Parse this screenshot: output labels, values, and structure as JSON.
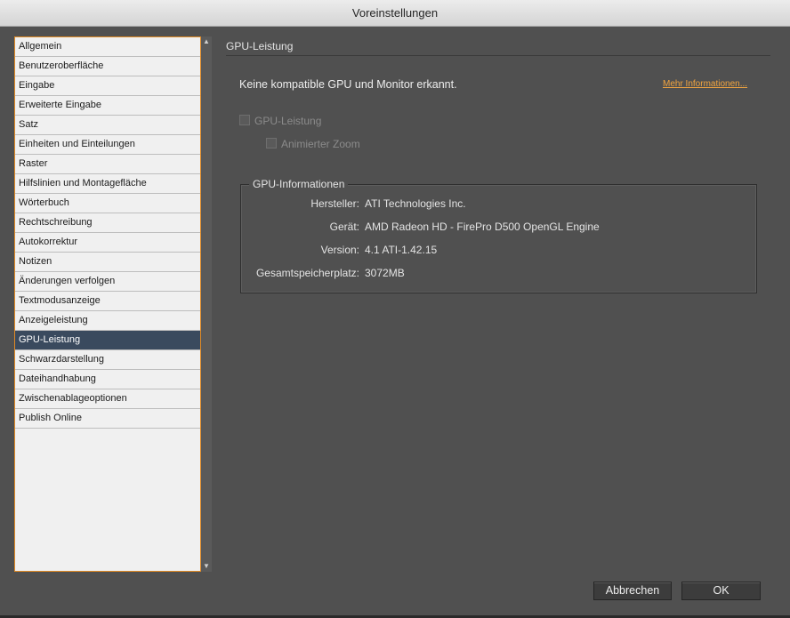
{
  "window": {
    "title": "Voreinstellungen"
  },
  "sidebar": {
    "items": [
      {
        "label": "Allgemein",
        "selected": false
      },
      {
        "label": "Benutzeroberfläche",
        "selected": false
      },
      {
        "label": "Eingabe",
        "selected": false
      },
      {
        "label": "Erweiterte Eingabe",
        "selected": false
      },
      {
        "label": "Satz",
        "selected": false
      },
      {
        "label": "Einheiten und Einteilungen",
        "selected": false
      },
      {
        "label": "Raster",
        "selected": false
      },
      {
        "label": "Hilfslinien und Montagefläche",
        "selected": false
      },
      {
        "label": "Wörterbuch",
        "selected": false
      },
      {
        "label": "Rechtschreibung",
        "selected": false
      },
      {
        "label": "Autokorrektur",
        "selected": false
      },
      {
        "label": "Notizen",
        "selected": false
      },
      {
        "label": "Änderungen verfolgen",
        "selected": false
      },
      {
        "label": "Textmodusanzeige",
        "selected": false
      },
      {
        "label": "Anzeigeleistung",
        "selected": false
      },
      {
        "label": "GPU-Leistung",
        "selected": true
      },
      {
        "label": "Schwarzdarstellung",
        "selected": false
      },
      {
        "label": "Dateihandhabung",
        "selected": false
      },
      {
        "label": "Zwischenablageoptionen",
        "selected": false
      },
      {
        "label": "Publish Online",
        "selected": false
      }
    ]
  },
  "icons": {
    "scroll_up": "▲",
    "scroll_down": "▼"
  },
  "main": {
    "section_title": "GPU-Leistung",
    "status_text": "Keine kompatible GPU und Monitor erkannt.",
    "more_info_link": "Mehr Informationen...",
    "gpu_performance_checkbox": {
      "label": "GPU-Leistung",
      "checked": false,
      "enabled": false
    },
    "animated_zoom_checkbox": {
      "label": "Animierter Zoom",
      "checked": false,
      "enabled": false
    },
    "gpu_info": {
      "legend": "GPU-Informationen",
      "rows": [
        {
          "label": "Hersteller:",
          "value": "ATI Technologies Inc."
        },
        {
          "label": "Gerät:",
          "value": "AMD Radeon HD - FirePro D500 OpenGL Engine"
        },
        {
          "label": "Version:",
          "value": "4.1 ATI-1.42.15"
        },
        {
          "label": "Gesamtspeicherplatz:",
          "value": "3072MB"
        }
      ]
    }
  },
  "footer": {
    "cancel_label": "Abbrechen",
    "ok_label": "OK"
  },
  "colors": {
    "accent": "#f0a440",
    "selection": "#3a4a5e",
    "dialog_bg": "#505050"
  }
}
